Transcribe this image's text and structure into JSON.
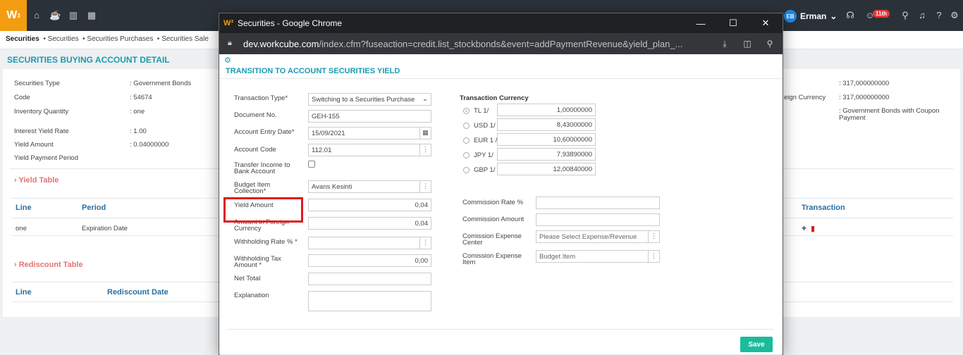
{
  "app": {
    "logo": "W",
    "logo_sup": "3",
    "user_initials": "EB",
    "user_name": "Erman",
    "notification_badge": "11th"
  },
  "breadcrumbs": {
    "items": [
      "Securities",
      "Securities",
      "Securities Purchases",
      "Securities Sale"
    ]
  },
  "page": {
    "title": "SECURITIES BUYING ACCOUNT DETAIL",
    "details": [
      {
        "label": "Securities Type",
        "value": ": Government Bonds"
      },
      {
        "label": "Code",
        "value": ": 54674"
      },
      {
        "label": "Inventory Quantity",
        "value": ": one"
      },
      {
        "label": "Interest Yield Rate",
        "value": ": 1.00"
      },
      {
        "label": "Yield Amount",
        "value": ": 0.04000000"
      },
      {
        "label": "Yield Payment Period",
        "value": ""
      }
    ],
    "right_details": [
      {
        "label": "",
        "value": ": 317,000000000"
      },
      {
        "label": "eign Currency",
        "value": ": 317,000000000"
      },
      {
        "label": "",
        "value": ": Government Bonds with Coupon Payment"
      }
    ],
    "yield_table": {
      "title": "Yield Table",
      "headers": [
        "Line",
        "Period",
        "Transaction"
      ],
      "row": {
        "line": "one",
        "period": "Expiration Date"
      }
    },
    "rediscount_table": {
      "title": "Rediscount Table",
      "headers": [
        "Line",
        "Rediscount Date"
      ]
    }
  },
  "popup": {
    "window_title": "Securities - Google Chrome",
    "url_domain": "dev.workcube.com",
    "url_path": "/index.cfm?fuseaction=credit.list_stockbonds&event=addPaymentRevenue&yield_plan_...",
    "title": "TRANSITION TO ACCOUNT SECURITIES YIELD",
    "form": {
      "transaction_type_label": "Transaction Type*",
      "transaction_type_value": "Switching to a Securities Purchase",
      "document_no_label": "Document No.",
      "document_no_value": "GEH-155",
      "account_entry_date_label": "Account Entry Date*",
      "account_entry_date_value": "15/09/2021",
      "account_code_label": "Account Code",
      "account_code_value": "112.01",
      "transfer_income_label_1": "Transfer Income to",
      "transfer_income_label_2": "Bank Account",
      "budget_item_label_1": "Budget Item",
      "budget_item_label_2": "Collection*",
      "budget_item_value": "Avans Kesinti",
      "yield_amount_label": "Yield Amount",
      "yield_amount_value": "0,04",
      "amount_foreign_label_1": "Amount in Foreign",
      "amount_foreign_label_2": "Currency",
      "amount_foreign_value": "0,04",
      "withholding_rate_label": "Withholding Rate % *",
      "withholding_tax_label_1": "Withholding Tax",
      "withholding_tax_label_2": "Amount *",
      "withholding_tax_value": "0,00",
      "net_total_label": "Net Total",
      "explanation_label": "Explanation"
    },
    "currency": {
      "title": "Transaction Currency",
      "rows": [
        {
          "label": "TL 1/",
          "value": "1,00000000",
          "selected": true
        },
        {
          "label": "USD 1/",
          "value": "8,43000000",
          "selected": false
        },
        {
          "label": "EUR 1 /",
          "value": "10,60000000",
          "selected": false
        },
        {
          "label": "JPY 1/",
          "value": "7,93890000",
          "selected": false
        },
        {
          "label": "GBP 1/",
          "value": "12,00840000",
          "selected": false
        }
      ]
    },
    "commission": {
      "rate_label": "Commission Rate %",
      "amount_label": "Commission Amount",
      "expense_center_label_1": "Comission Expense",
      "expense_center_label_2": "Center",
      "expense_center_placeholder": "Please Select Expense/Revenue",
      "expense_item_label_1": "Comission Expense",
      "expense_item_label_2": "Item",
      "expense_item_placeholder": "Budget Item"
    },
    "save_label": "Save"
  }
}
